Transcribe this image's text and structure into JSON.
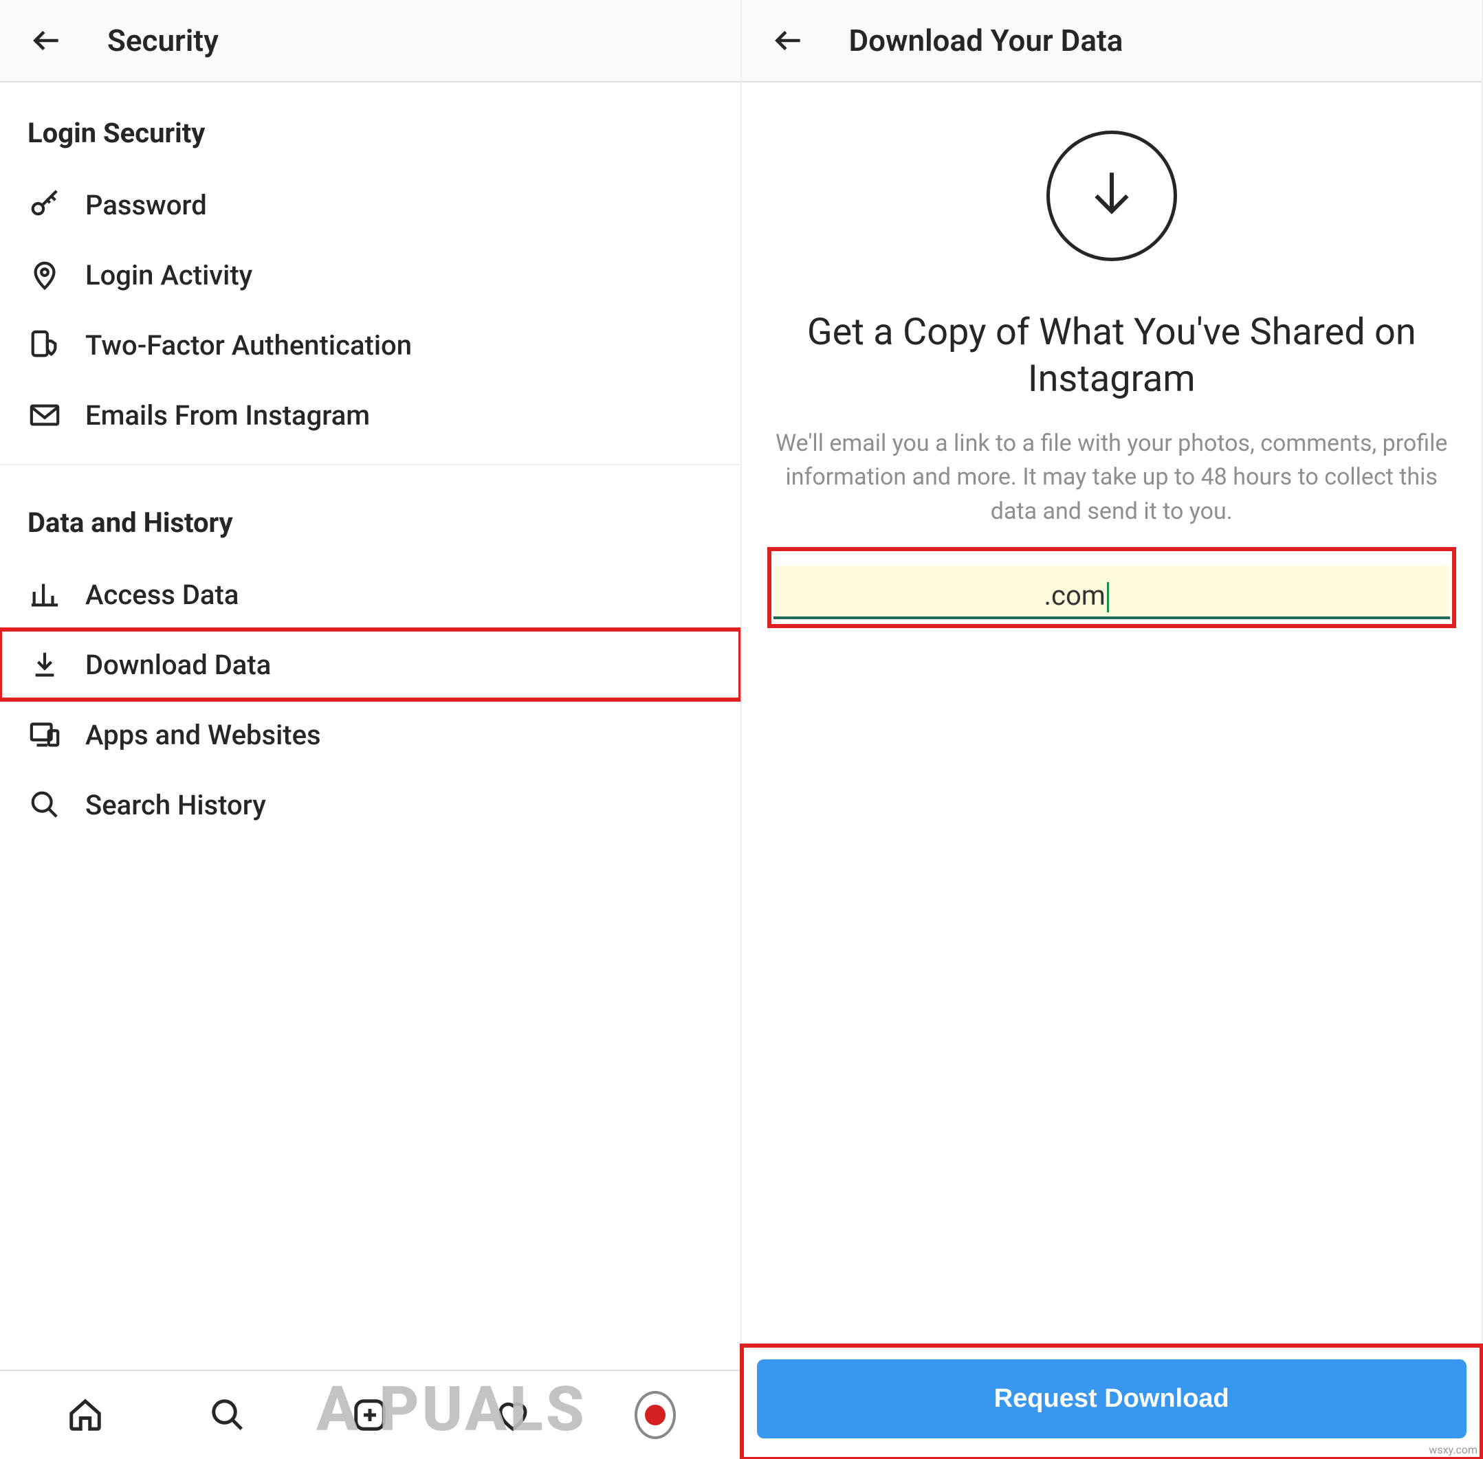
{
  "left": {
    "header_title": "Security",
    "section_login": "Login Security",
    "items_login": {
      "password": "Password",
      "login_activity": "Login Activity",
      "two_factor": "Two-Factor Authentication",
      "emails_from": "Emails From Instagram"
    },
    "section_data": "Data and History",
    "items_data": {
      "access_data": "Access Data",
      "download_data": "Download Data",
      "apps_websites": "Apps and Websites",
      "search_history": "Search History"
    }
  },
  "right": {
    "header_title": "Download Your Data",
    "big_title": "Get a Copy of What You've Shared on Instagram",
    "description": "We'll email you a link to a file with your photos, comments, profile information and more. It may take up to 48 hours to collect this data and send it to you.",
    "email_suffix": ".com",
    "request_button": "Request Download"
  },
  "watermark": "A  PUALS",
  "source_note": "wsxy.com"
}
